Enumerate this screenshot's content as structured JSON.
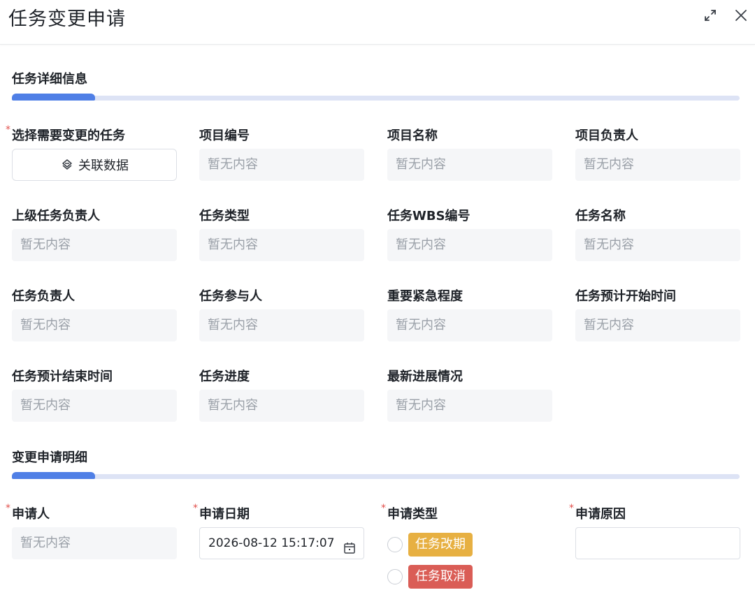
{
  "header": {
    "title": "任务变更申请",
    "expand_icon": "expand-icon",
    "close_icon": "close-icon"
  },
  "task_section": {
    "title": "任务详细信息",
    "select_task": {
      "label": "选择需要变更的任务",
      "button_label": "关联数据",
      "button_icon": "link-icon"
    },
    "fields": [
      {
        "label": "项目编号",
        "value": "暂无内容"
      },
      {
        "label": "项目名称",
        "value": "暂无内容"
      },
      {
        "label": "项目负责人",
        "value": "暂无内容"
      },
      {
        "label": "上级任务负责人",
        "value": "暂无内容"
      },
      {
        "label": "任务类型",
        "value": "暂无内容"
      },
      {
        "label": "任务WBS编号",
        "value": "暂无内容"
      },
      {
        "label": "任务名称",
        "value": "暂无内容"
      },
      {
        "label": "任务负责人",
        "value": "暂无内容"
      },
      {
        "label": "任务参与人",
        "value": "暂无内容"
      },
      {
        "label": "重要紧急程度",
        "value": "暂无内容"
      },
      {
        "label": "任务预计开始时间",
        "value": "暂无内容"
      },
      {
        "label": "任务预计结束时间",
        "value": "暂无内容"
      },
      {
        "label": "任务进度",
        "value": "暂无内容"
      },
      {
        "label": "最新进展情况",
        "value": "暂无内容"
      }
    ]
  },
  "change_section": {
    "title": "变更申请明细",
    "applicant": {
      "label": "申请人",
      "value": "暂无内容"
    },
    "apply_date": {
      "label": "申请日期",
      "value": "2026-08-12 15:17:07"
    },
    "apply_type": {
      "label": "申请类型",
      "options": [
        "任务改期",
        "任务取消"
      ]
    },
    "apply_reason": {
      "label": "申请原因",
      "value": ""
    }
  },
  "colors": {
    "accent": "#4f7fe6",
    "required": "#e2504c",
    "tag_reschedule": "#e7b042",
    "tag_cancel": "#da5d56"
  }
}
